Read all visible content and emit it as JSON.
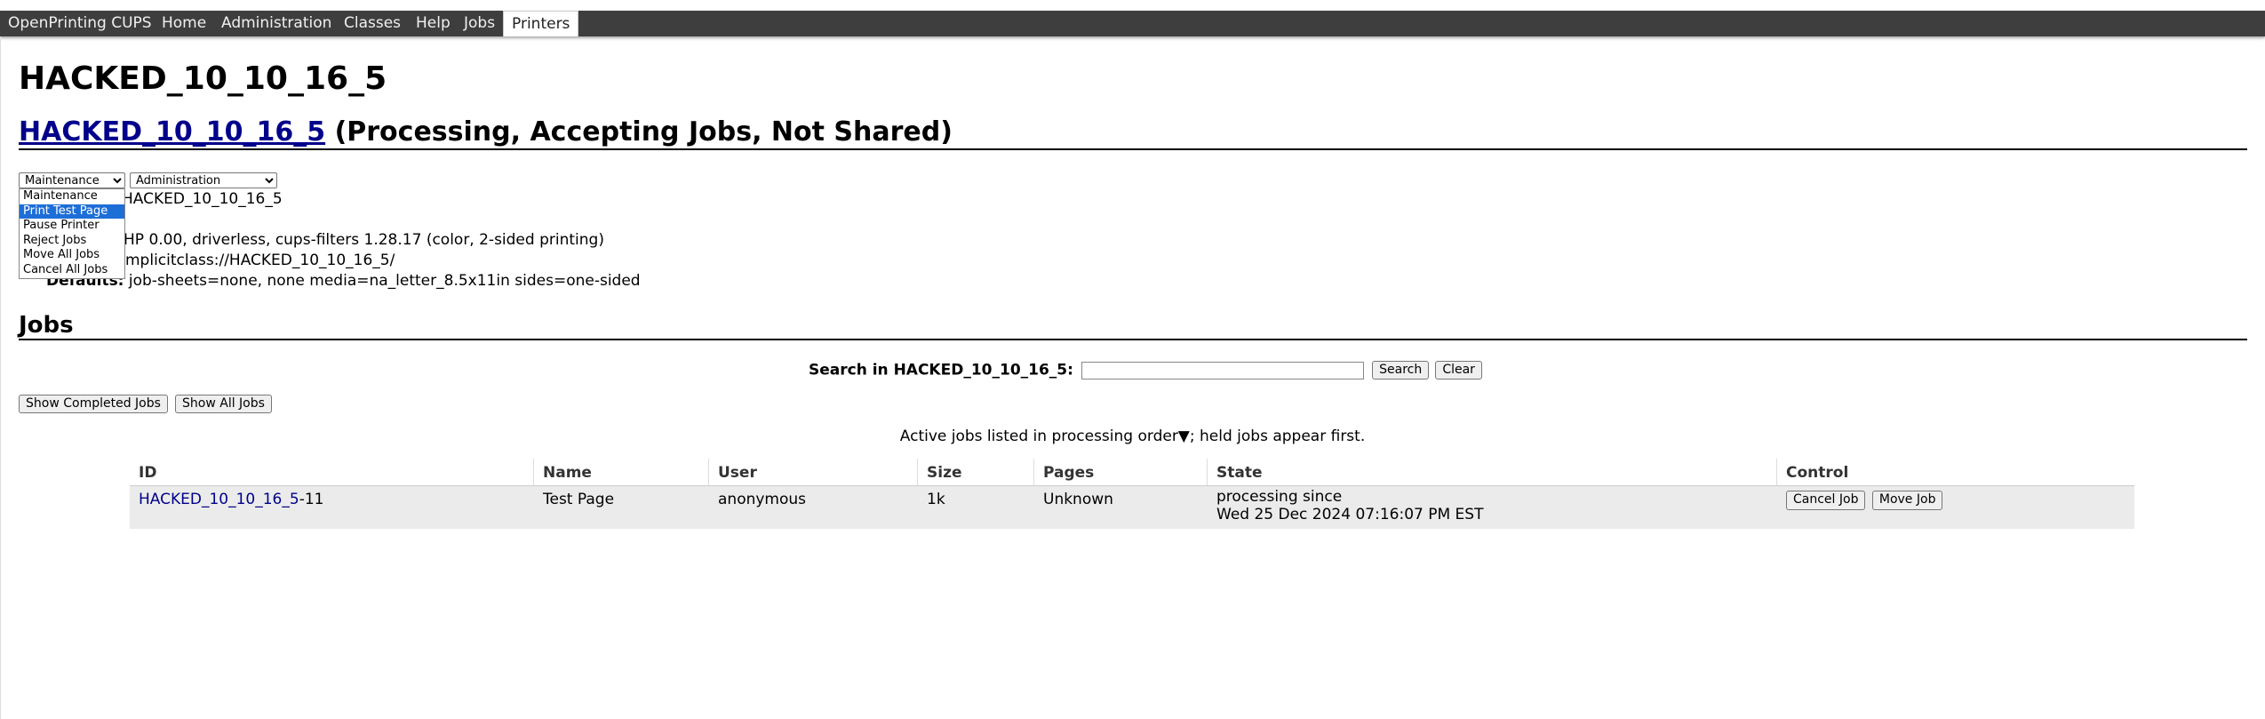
{
  "nav": {
    "items": [
      "OpenPrinting CUPS",
      "Home",
      "Administration",
      "Classes",
      "Help",
      "Jobs",
      "Printers"
    ],
    "active": "Printers"
  },
  "page": {
    "title": "HACKED_10_10_16_5",
    "printer_link": "HACKED_10_10_16_5",
    "printer_status": "(Processing, Accepting Jobs, Not Shared)"
  },
  "maintenance_select": {
    "selected": "Maintenance",
    "options": [
      "Maintenance",
      "Print Test Page",
      "Pause Printer",
      "Reject Jobs",
      "Move All Jobs",
      "Cancel All Jobs"
    ],
    "highlighted": "Print Test Page"
  },
  "administration_select": {
    "selected": "Administration"
  },
  "info": {
    "description_partial": "HACKED_10_10_16_5",
    "driver_partial": "HP 0.00, driverless, cups-filters 1.28.17 (color, 2-sided printing)",
    "connection_partial": "mplicitclass://HACKED_10_10_16_5/",
    "defaults_label": "Defaults:",
    "defaults_value": "job-sheets=none, none media=na_letter_8.5x11in sides=one-sided"
  },
  "jobs": {
    "heading": "Jobs",
    "search_label": "Search in HACKED_10_10_16_5:",
    "search_value": "",
    "search_button": "Search",
    "clear_button": "Clear",
    "show_completed": "Show Completed Jobs",
    "show_all": "Show All Jobs",
    "order_note": "Active jobs listed in processing order▼; held jobs appear first.",
    "columns": [
      "ID",
      "Name",
      "User",
      "Size",
      "Pages",
      "State",
      "Control"
    ],
    "rows": [
      {
        "id_link": "HACKED_10_10_16_5",
        "id_suffix": "-11",
        "name": "Test Page",
        "user": "anonymous",
        "size": "1k",
        "pages": "Unknown",
        "state_line1": "processing since",
        "state_line2": "Wed 25 Dec 2024 07:16:07 PM EST",
        "cancel_button": "Cancel Job",
        "move_button": "Move Job"
      }
    ]
  }
}
